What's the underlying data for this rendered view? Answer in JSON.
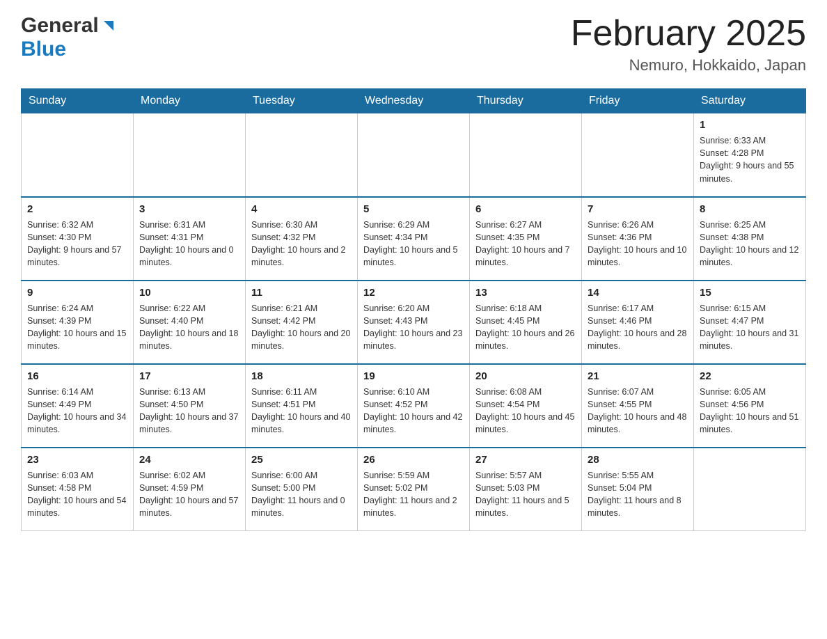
{
  "header": {
    "logo_general": "General",
    "logo_blue": "Blue",
    "title": "February 2025",
    "location": "Nemuro, Hokkaido, Japan"
  },
  "calendar": {
    "days_of_week": [
      "Sunday",
      "Monday",
      "Tuesday",
      "Wednesday",
      "Thursday",
      "Friday",
      "Saturday"
    ],
    "weeks": [
      [
        {
          "day": "",
          "info": ""
        },
        {
          "day": "",
          "info": ""
        },
        {
          "day": "",
          "info": ""
        },
        {
          "day": "",
          "info": ""
        },
        {
          "day": "",
          "info": ""
        },
        {
          "day": "",
          "info": ""
        },
        {
          "day": "1",
          "info": "Sunrise: 6:33 AM\nSunset: 4:28 PM\nDaylight: 9 hours and 55 minutes."
        }
      ],
      [
        {
          "day": "2",
          "info": "Sunrise: 6:32 AM\nSunset: 4:30 PM\nDaylight: 9 hours and 57 minutes."
        },
        {
          "day": "3",
          "info": "Sunrise: 6:31 AM\nSunset: 4:31 PM\nDaylight: 10 hours and 0 minutes."
        },
        {
          "day": "4",
          "info": "Sunrise: 6:30 AM\nSunset: 4:32 PM\nDaylight: 10 hours and 2 minutes."
        },
        {
          "day": "5",
          "info": "Sunrise: 6:29 AM\nSunset: 4:34 PM\nDaylight: 10 hours and 5 minutes."
        },
        {
          "day": "6",
          "info": "Sunrise: 6:27 AM\nSunset: 4:35 PM\nDaylight: 10 hours and 7 minutes."
        },
        {
          "day": "7",
          "info": "Sunrise: 6:26 AM\nSunset: 4:36 PM\nDaylight: 10 hours and 10 minutes."
        },
        {
          "day": "8",
          "info": "Sunrise: 6:25 AM\nSunset: 4:38 PM\nDaylight: 10 hours and 12 minutes."
        }
      ],
      [
        {
          "day": "9",
          "info": "Sunrise: 6:24 AM\nSunset: 4:39 PM\nDaylight: 10 hours and 15 minutes."
        },
        {
          "day": "10",
          "info": "Sunrise: 6:22 AM\nSunset: 4:40 PM\nDaylight: 10 hours and 18 minutes."
        },
        {
          "day": "11",
          "info": "Sunrise: 6:21 AM\nSunset: 4:42 PM\nDaylight: 10 hours and 20 minutes."
        },
        {
          "day": "12",
          "info": "Sunrise: 6:20 AM\nSunset: 4:43 PM\nDaylight: 10 hours and 23 minutes."
        },
        {
          "day": "13",
          "info": "Sunrise: 6:18 AM\nSunset: 4:45 PM\nDaylight: 10 hours and 26 minutes."
        },
        {
          "day": "14",
          "info": "Sunrise: 6:17 AM\nSunset: 4:46 PM\nDaylight: 10 hours and 28 minutes."
        },
        {
          "day": "15",
          "info": "Sunrise: 6:15 AM\nSunset: 4:47 PM\nDaylight: 10 hours and 31 minutes."
        }
      ],
      [
        {
          "day": "16",
          "info": "Sunrise: 6:14 AM\nSunset: 4:49 PM\nDaylight: 10 hours and 34 minutes."
        },
        {
          "day": "17",
          "info": "Sunrise: 6:13 AM\nSunset: 4:50 PM\nDaylight: 10 hours and 37 minutes."
        },
        {
          "day": "18",
          "info": "Sunrise: 6:11 AM\nSunset: 4:51 PM\nDaylight: 10 hours and 40 minutes."
        },
        {
          "day": "19",
          "info": "Sunrise: 6:10 AM\nSunset: 4:52 PM\nDaylight: 10 hours and 42 minutes."
        },
        {
          "day": "20",
          "info": "Sunrise: 6:08 AM\nSunset: 4:54 PM\nDaylight: 10 hours and 45 minutes."
        },
        {
          "day": "21",
          "info": "Sunrise: 6:07 AM\nSunset: 4:55 PM\nDaylight: 10 hours and 48 minutes."
        },
        {
          "day": "22",
          "info": "Sunrise: 6:05 AM\nSunset: 4:56 PM\nDaylight: 10 hours and 51 minutes."
        }
      ],
      [
        {
          "day": "23",
          "info": "Sunrise: 6:03 AM\nSunset: 4:58 PM\nDaylight: 10 hours and 54 minutes."
        },
        {
          "day": "24",
          "info": "Sunrise: 6:02 AM\nSunset: 4:59 PM\nDaylight: 10 hours and 57 minutes."
        },
        {
          "day": "25",
          "info": "Sunrise: 6:00 AM\nSunset: 5:00 PM\nDaylight: 11 hours and 0 minutes."
        },
        {
          "day": "26",
          "info": "Sunrise: 5:59 AM\nSunset: 5:02 PM\nDaylight: 11 hours and 2 minutes."
        },
        {
          "day": "27",
          "info": "Sunrise: 5:57 AM\nSunset: 5:03 PM\nDaylight: 11 hours and 5 minutes."
        },
        {
          "day": "28",
          "info": "Sunrise: 5:55 AM\nSunset: 5:04 PM\nDaylight: 11 hours and 8 minutes."
        },
        {
          "day": "",
          "info": ""
        }
      ]
    ]
  }
}
